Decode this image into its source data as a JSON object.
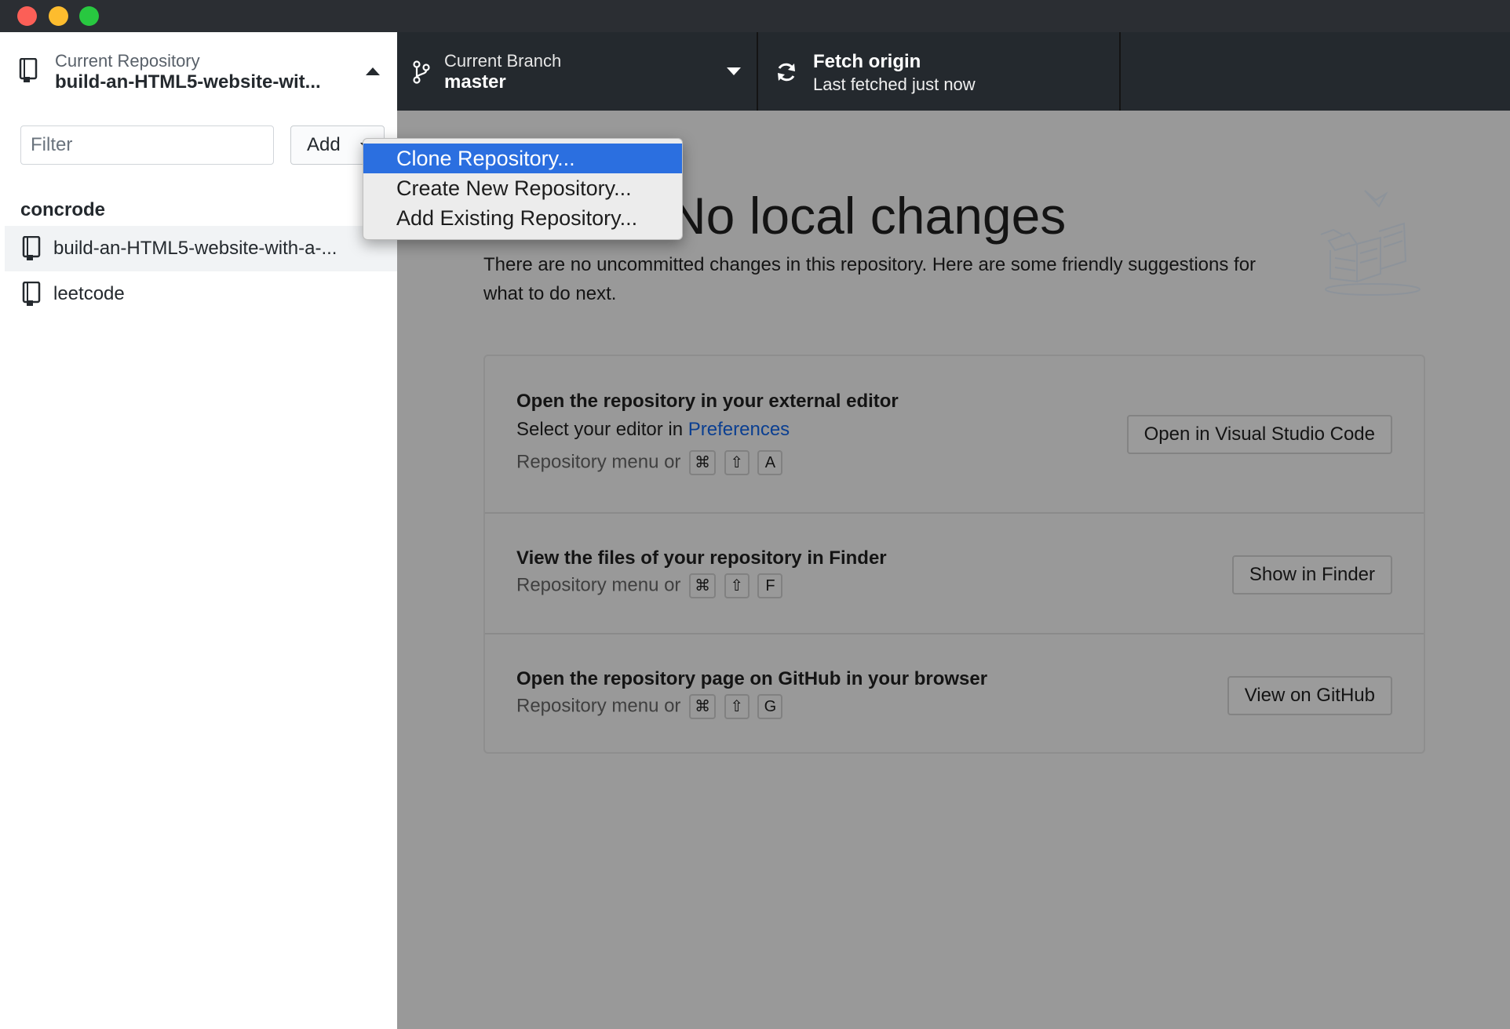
{
  "toolbar": {
    "repository": {
      "label": "Current Repository",
      "name": "build-an-HTML5-website-wit..."
    },
    "branch": {
      "label": "Current Branch",
      "name": "master"
    },
    "fetch": {
      "title": "Fetch origin",
      "subtitle": "Last fetched just now"
    }
  },
  "sidebar": {
    "filter_placeholder": "Filter",
    "add_label": "Add",
    "group": "concrode",
    "repos": [
      {
        "name": "build-an-HTML5-website-with-a-..."
      },
      {
        "name": "leetcode"
      }
    ]
  },
  "add_menu": {
    "items": [
      {
        "label": "Clone Repository..."
      },
      {
        "label": "Create New Repository..."
      },
      {
        "label": "Add Existing Repository..."
      }
    ]
  },
  "main": {
    "heading": "No local changes",
    "description": "There are no uncommitted changes in this repository. Here are some friendly suggestions for what to do next.",
    "suggestions": [
      {
        "title": "Open the repository in your external editor",
        "subtitle_prefix": "Select your editor in ",
        "subtitle_link": "Preferences",
        "hint": "Repository menu or",
        "keys": [
          "⌘",
          "⇧",
          "A"
        ],
        "button": "Open in Visual Studio Code"
      },
      {
        "title": "View the files of your repository in Finder",
        "hint": "Repository menu or",
        "keys": [
          "⌘",
          "⇧",
          "F"
        ],
        "button": "Show in Finder"
      },
      {
        "title": "Open the repository page on GitHub in your browser",
        "hint": "Repository menu or",
        "keys": [
          "⌘",
          "⇧",
          "G"
        ],
        "button": "View on GitHub"
      }
    ]
  }
}
